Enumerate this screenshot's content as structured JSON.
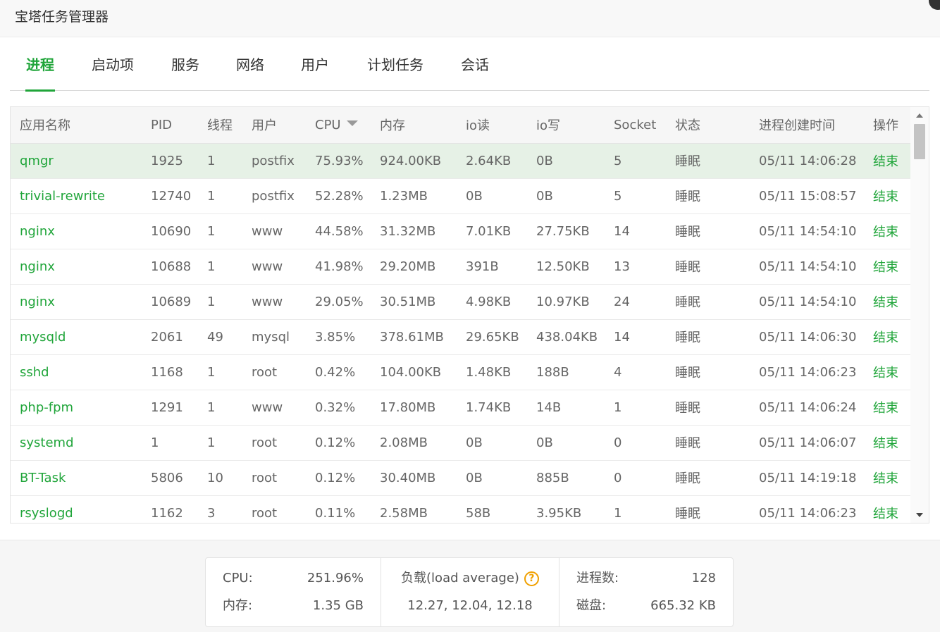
{
  "window": {
    "title": "宝塔任务管理器"
  },
  "tabs": [
    {
      "label": "进程",
      "active": true
    },
    {
      "label": "启动项",
      "active": false
    },
    {
      "label": "服务",
      "active": false
    },
    {
      "label": "网络",
      "active": false
    },
    {
      "label": "用户",
      "active": false
    },
    {
      "label": "计划任务",
      "active": false
    },
    {
      "label": "会话",
      "active": false
    }
  ],
  "table": {
    "columns": [
      "应用名称",
      "PID",
      "线程",
      "用户",
      "CPU",
      "内存",
      "io读",
      "io写",
      "Socket",
      "状态",
      "进程创建时间",
      "操作"
    ],
    "sort_column": "CPU",
    "rows": [
      [
        "qmgr",
        "1925",
        "1",
        "postfix",
        "75.93%",
        "924.00KB",
        "2.64KB",
        "0B",
        "5",
        "睡眠",
        "05/11 14:06:28",
        "结束"
      ],
      [
        "trivial-rewrite",
        "12740",
        "1",
        "postfix",
        "52.28%",
        "1.23MB",
        "0B",
        "0B",
        "5",
        "睡眠",
        "05/11 15:08:57",
        "结束"
      ],
      [
        "nginx",
        "10690",
        "1",
        "www",
        "44.58%",
        "31.32MB",
        "7.01KB",
        "27.75KB",
        "14",
        "睡眠",
        "05/11 14:54:10",
        "结束"
      ],
      [
        "nginx",
        "10688",
        "1",
        "www",
        "41.98%",
        "29.20MB",
        "391B",
        "12.50KB",
        "13",
        "睡眠",
        "05/11 14:54:10",
        "结束"
      ],
      [
        "nginx",
        "10689",
        "1",
        "www",
        "29.05%",
        "30.51MB",
        "4.98KB",
        "10.97KB",
        "24",
        "睡眠",
        "05/11 14:54:10",
        "结束"
      ],
      [
        "mysqld",
        "2061",
        "49",
        "mysql",
        "3.85%",
        "378.61MB",
        "29.65KB",
        "438.04KB",
        "14",
        "睡眠",
        "05/11 14:06:30",
        "结束"
      ],
      [
        "sshd",
        "1168",
        "1",
        "root",
        "0.42%",
        "104.00KB",
        "1.48KB",
        "188B",
        "4",
        "睡眠",
        "05/11 14:06:23",
        "结束"
      ],
      [
        "php-fpm",
        "1291",
        "1",
        "www",
        "0.32%",
        "17.80MB",
        "1.74KB",
        "14B",
        "1",
        "睡眠",
        "05/11 14:06:24",
        "结束"
      ],
      [
        "systemd",
        "1",
        "1",
        "root",
        "0.12%",
        "2.08MB",
        "0B",
        "0B",
        "0",
        "睡眠",
        "05/11 14:06:07",
        "结束"
      ],
      [
        "BT-Task",
        "5806",
        "10",
        "root",
        "0.12%",
        "30.40MB",
        "0B",
        "885B",
        "0",
        "睡眠",
        "05/11 14:19:18",
        "结束"
      ],
      [
        "rsyslogd",
        "1162",
        "3",
        "root",
        "0.11%",
        "2.58MB",
        "58B",
        "3.95KB",
        "1",
        "睡眠",
        "05/11 14:06:23",
        "结束"
      ]
    ]
  },
  "stats": {
    "cpu_label": "CPU:",
    "cpu_value": "251.96%",
    "mem_label": "内存:",
    "mem_value": "1.35 GB",
    "load_label": "负载(load average)",
    "load_help": "?",
    "load_value": "12.27, 12.04, 12.18",
    "proc_label": "进程数:",
    "proc_value": "128",
    "disk_label": "磁盘:",
    "disk_value": "665.32 KB"
  },
  "colors": {
    "accent": "#20a53a",
    "selected_row": "#e6f1e6",
    "help": "#f0a000"
  }
}
